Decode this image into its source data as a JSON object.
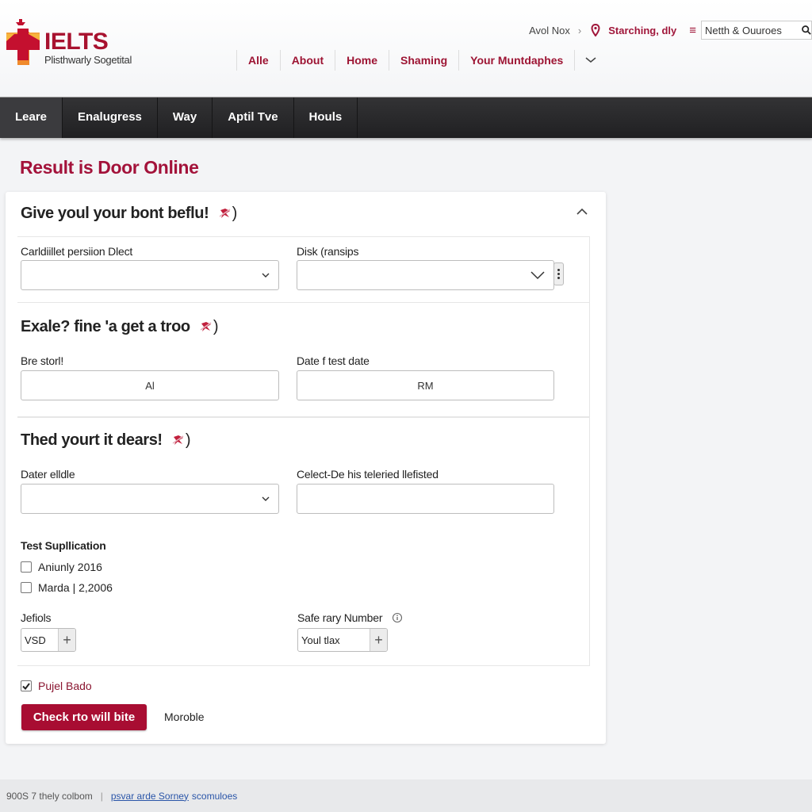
{
  "brand": {
    "title": "IELTS",
    "subtitle": "Plisthwarly Sogetital",
    "colors": {
      "primary": "#a80d32",
      "accent_orange": "#f08a2c",
      "dark_bar": "#2a2a2c"
    }
  },
  "topbar": {
    "crumb": "Avol Nox",
    "location_icon": "map-pin-icon",
    "location": "Starching, dly",
    "menu_icon": "hamburger-icon",
    "search_value": "Netth & Ouuroes",
    "search_icon": "search-icon"
  },
  "main_nav": {
    "items": [
      "Alle",
      "About",
      "Home",
      "Shaming",
      "Your Muntdaphes"
    ],
    "more_icon": "chevron-down-icon"
  },
  "tabs": {
    "items": [
      "Leare",
      "Enalugress",
      "Way",
      "Aptil Tve",
      "Houls"
    ],
    "active": "Leare"
  },
  "page": {
    "title": "Result is Door Online"
  },
  "form": {
    "section1": {
      "heading": "Give youl your bont beflu!",
      "heading_suffix": ")",
      "collapse_icon": "chevron-up-icon",
      "field1": {
        "label": "Carldiillet persiion Dlect",
        "value": ""
      },
      "field2": {
        "label": "Disk (ransips",
        "value": ""
      }
    },
    "section2": {
      "heading": "Exale? fine 'a get a troo",
      "heading_suffix": ")",
      "field1": {
        "label": "Bre storl!",
        "value": "Al"
      },
      "field2": {
        "label": "Date f test date",
        "value": "RM"
      }
    },
    "section3": {
      "heading": "Thed yourt it dears!",
      "heading_suffix": ")",
      "field1": {
        "label": "Dater elldle",
        "value": ""
      },
      "field2": {
        "label": "Celect-De his teleried llefisted",
        "value": ""
      }
    },
    "supplication": {
      "label": "Test Supllication",
      "options": [
        {
          "label": "Aniunly 2016",
          "checked": false
        },
        {
          "label": "Marda | 2,2006",
          "checked": false
        }
      ]
    },
    "stepper1": {
      "label": "Jefiols",
      "value": "VSD"
    },
    "stepper2": {
      "label": "Safe rary Number",
      "value": "Youl tlax",
      "info_icon": "info-icon"
    },
    "confirm": {
      "label": "Pujel Bado",
      "checked": true
    },
    "submit_label": "Check rto will bite",
    "secondary_label": "Moroble"
  },
  "footer": {
    "left_text": "900S 7 thely colbom",
    "link_text": "psvar arde Sorney",
    "tail_text": "scomuloes"
  }
}
